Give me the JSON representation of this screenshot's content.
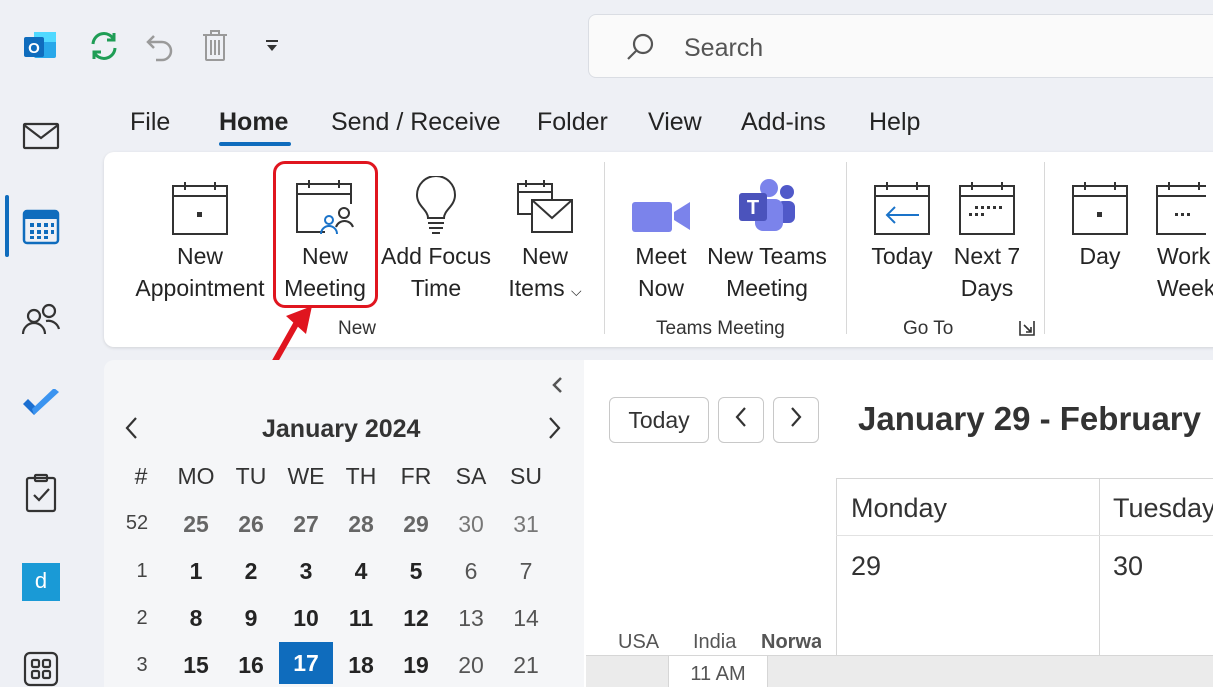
{
  "search": {
    "placeholder": "Search"
  },
  "menu": {
    "tabs": [
      "File",
      "Home",
      "Send / Receive",
      "Folder",
      "View",
      "Add-ins",
      "Help"
    ]
  },
  "ribbon": {
    "new_appointment": [
      "New",
      "Appointment"
    ],
    "new_meeting": [
      "New",
      "Meeting"
    ],
    "add_focus_time": [
      "Add Focus",
      "Time"
    ],
    "new_items": [
      "New",
      "Items"
    ],
    "meet_now": [
      "Meet",
      "Now"
    ],
    "new_teams_meeting": [
      "New Teams",
      "Meeting"
    ],
    "today": [
      "Today"
    ],
    "next_7_days": [
      "Next 7",
      "Days"
    ],
    "day": [
      "Day"
    ],
    "work_week": [
      "Work",
      "Week"
    ],
    "group_new": "New",
    "group_teams": "Teams Meeting",
    "group_goto": "Go To"
  },
  "navigator": {
    "month": "January 2024",
    "headers": [
      "#",
      "MO",
      "TU",
      "WE",
      "TH",
      "FR",
      "SA",
      "SU"
    ],
    "rows": [
      [
        "52",
        "25",
        "26",
        "27",
        "28",
        "29",
        "30",
        "31"
      ],
      [
        "1",
        "1",
        "2",
        "3",
        "4",
        "5",
        "6",
        "7"
      ],
      [
        "2",
        "8",
        "9",
        "10",
        "11",
        "12",
        "13",
        "14"
      ],
      [
        "3",
        "15",
        "16",
        "17",
        "18",
        "19",
        "20",
        "21"
      ]
    ],
    "selected": "17"
  },
  "calendar": {
    "today_label": "Today",
    "range_title": "January 29 - February",
    "days": [
      {
        "name": "Monday",
        "num": "29"
      },
      {
        "name": "Tuesday",
        "num": "30"
      }
    ],
    "timezones": [
      "USA",
      "India",
      "Norwa"
    ],
    "time_slot": "11 AM"
  },
  "colors": {
    "accent": "#0f6cbd",
    "highlight": "#e0151f"
  }
}
